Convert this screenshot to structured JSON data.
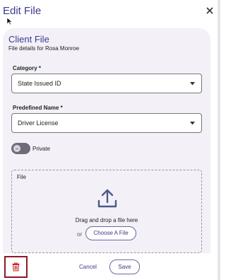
{
  "dialog": {
    "title": "Edit File",
    "close_icon": "close-icon"
  },
  "card": {
    "title": "Client File",
    "subtitle": "File details for Rosa Monroe"
  },
  "category": {
    "label": "Category *",
    "value": "State Issued ID"
  },
  "predefined_name": {
    "label": "Predefined Name *",
    "value": "Driver License"
  },
  "private_toggle": {
    "label": "Private",
    "on": false
  },
  "file": {
    "label": "File",
    "drop_text": "Drag and drop a file here",
    "or_text": "or",
    "choose_label": "Choose A File"
  },
  "footer": {
    "cancel_label": "Cancel",
    "save_label": "Save",
    "delete_icon": "trash-icon"
  },
  "colors": {
    "accent": "#3a3a8c",
    "highlight_border": "#8b1a24",
    "trash": "#c62828",
    "card_bg": "#f3f0f8"
  }
}
